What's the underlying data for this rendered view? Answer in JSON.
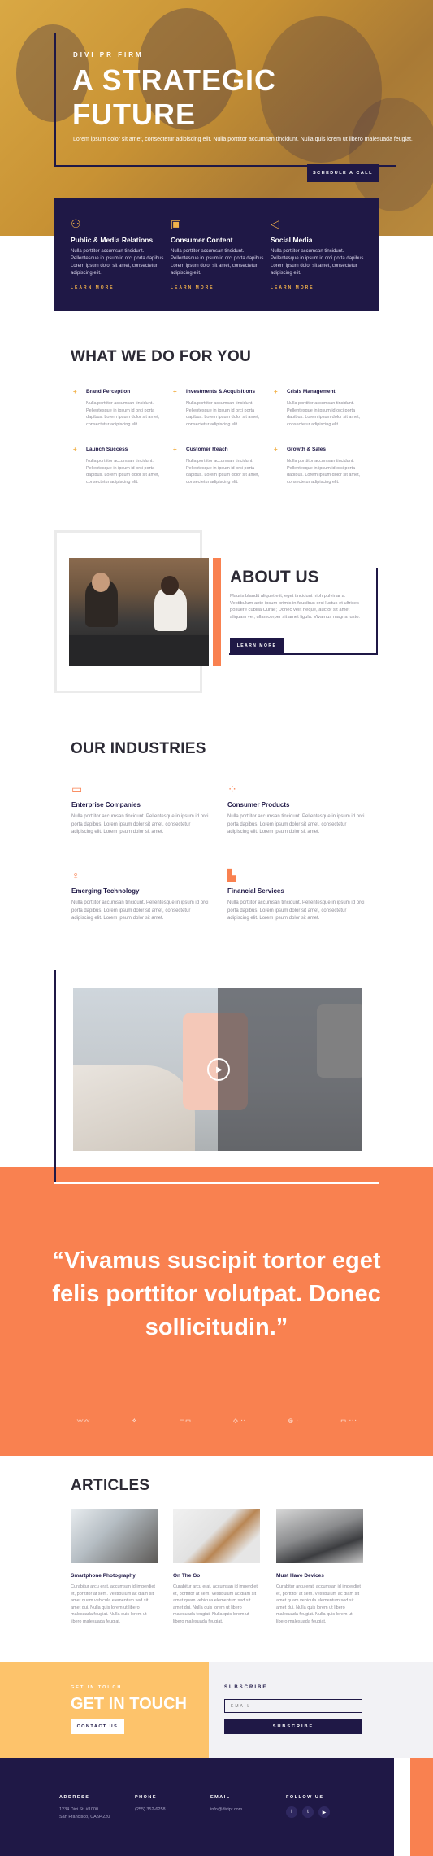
{
  "hero": {
    "eyebrow": "DIVI PR FIRM",
    "title": "A STRATEGIC FUTURE",
    "subtitle": "Lorem ipsum dolor sit amet, consectetur adipiscing elit. Nulla porttitor accumsan tincidunt. Nulla quis lorem ut libero malesuada feugiat.",
    "button": "SCHEDULE A CALL"
  },
  "services": [
    {
      "icon": "network-icon",
      "title": "Public & Media Relations",
      "text": "Nulla porttitor accumsan tincidunt. Pellentesque in ipsum id orci porta dapibus. Lorem ipsum dolor sit amet, consectetur adipiscing elit.",
      "link": "LEARN MORE"
    },
    {
      "icon": "document-icon",
      "title": "Consumer Content",
      "text": "Nulla porttitor accumsan tincidunt. Pellentesque in ipsum id orci porta dapibus. Lorem ipsum dolor sit amet, consectetur adipiscing elit.",
      "link": "LEARN MORE"
    },
    {
      "icon": "megaphone-icon",
      "title": "Social Media",
      "text": "Nulla porttitor accumsan tincidunt. Pellentesque in ipsum id orci porta dapibus. Lorem ipsum dolor sit amet, consectetur adipiscing elit.",
      "link": "LEARN MORE"
    }
  ],
  "what_we_do": {
    "title": "WHAT WE DO FOR YOU",
    "items": [
      {
        "title": "Brand Perception",
        "text": "Nulla porttitor accumsan tincidunt. Pellentesque in ipsum id orci porta dapibus. Lorem ipsum dolor sit amet, consectetur adipiscing elit."
      },
      {
        "title": "Investments & Acquisitions",
        "text": "Nulla porttitor accumsan tincidunt. Pellentesque in ipsum id orci porta dapibus. Lorem ipsum dolor sit amet, consectetur adipiscing elit."
      },
      {
        "title": "Crisis Management",
        "text": "Nulla porttitor accumsan tincidunt. Pellentesque in ipsum id orci porta dapibus. Lorem ipsum dolor sit amet, consectetur adipiscing elit."
      },
      {
        "title": "Launch Success",
        "text": "Nulla porttitor accumsan tincidunt. Pellentesque in ipsum id orci porta dapibus. Lorem ipsum dolor sit amet, consectetur adipiscing elit."
      },
      {
        "title": "Customer Reach",
        "text": "Nulla porttitor accumsan tincidunt. Pellentesque in ipsum id orci porta dapibus. Lorem ipsum dolor sit amet, consectetur adipiscing elit."
      },
      {
        "title": "Growth & Sales",
        "text": "Nulla porttitor accumsan tincidunt. Pellentesque in ipsum id orci porta dapibus. Lorem ipsum dolor sit amet, consectetur adipiscing elit."
      }
    ]
  },
  "about": {
    "title": "ABOUT US",
    "text": "Mauris blandit aliquet elit, eget tincidunt nibh pulvinar a. Vestibulum ante ipsum primis in faucibus orci luctus et ultrices posuere cubilia Curae; Donec velit neque, auctor sit amet aliquam vel, ullamcorper sit amet ligula. Vivamus magna justo.",
    "button": "LEARN MORE"
  },
  "industries": {
    "title": "OUR INDUSTRIES",
    "items": [
      {
        "icon": "briefcase-icon",
        "title": "Enterprise Companies",
        "text": "Nulla porttitor accumsan tincidunt. Pellentesque in ipsum id orci porta dapibus. Lorem ipsum dolor sit amet, consectetur adipiscing elit. Lorem ipsum dolor sit amet."
      },
      {
        "icon": "molecule-icon",
        "title": "Consumer Products",
        "text": "Nulla porttitor accumsan tincidunt. Pellentesque in ipsum id orci porta dapibus. Lorem ipsum dolor sit amet, consectetur adipiscing elit. Lorem ipsum dolor sit amet."
      },
      {
        "icon": "lightbulb-icon",
        "title": "Emerging Technology",
        "text": "Nulla porttitor accumsan tincidunt. Pellentesque in ipsum id orci porta dapibus. Lorem ipsum dolor sit amet, consectetur adipiscing elit. Lorem ipsum dolor sit amet."
      },
      {
        "icon": "building-icon",
        "title": "Financial Services",
        "text": "Nulla porttitor accumsan tincidunt. Pellentesque in ipsum id orci porta dapibus. Lorem ipsum dolor sit amet, consectetur adipiscing elit. Lorem ipsum dolor sit amet."
      }
    ]
  },
  "quote": {
    "text": "“Vivamus suscipit tortor eget felis porttitor volutpat. Donec sollicitudin.”"
  },
  "articles": {
    "title": "ARTICLES",
    "items": [
      {
        "title": "Smartphone Photography",
        "text": "Curabitur arcu erat, accumsan id imperdiet et, porttitor at sem. Vestibulum ac diam sit amet quam vehicula elementum sed sit amet dui. Nulla quis lorem ut libero malesuada feugiat. Nulla quis lorem ut libero malesuada feugiat."
      },
      {
        "title": "On The Go",
        "text": "Curabitur arcu erat, accumsan id imperdiet et, porttitor at sem. Vestibulum ac diam sit amet quam vehicula elementum sed sit amet dui. Nulla quis lorem ut libero malesuada feugiat. Nulla quis lorem ut libero malesuada feugiat."
      },
      {
        "title": "Must Have Devices",
        "text": "Curabitur arcu erat, accumsan id imperdiet et, porttitor at sem. Vestibulum ac diam sit amet quam vehicula elementum sed sit amet dui. Nulla quis lorem ut libero malesuada feugiat. Nulla quis lorem ut libero malesuada feugiat."
      }
    ]
  },
  "contact": {
    "eyebrow": "GET IN TOUCH",
    "title": "GET IN TOUCH",
    "button": "CONTACT US"
  },
  "subscribe": {
    "label": "SUBSCRIBE",
    "placeholder": "EMAIL",
    "button": "SUBSCRIBE"
  },
  "footer": {
    "address_head": "ADDRESS",
    "address_line1": "1234 Divi St. #1000",
    "address_line2": "San Francisco, CA 94220",
    "phone_head": "PHONE",
    "phone": "(255) 352-6258",
    "email_head": "EMAIL",
    "email": "info@divipr.com",
    "follow_head": "FOLLOW US"
  },
  "colors": {
    "navy": "#1f1846",
    "orange": "#f98150",
    "gold": "#f2b24b",
    "light_gold": "#fdc36b"
  }
}
